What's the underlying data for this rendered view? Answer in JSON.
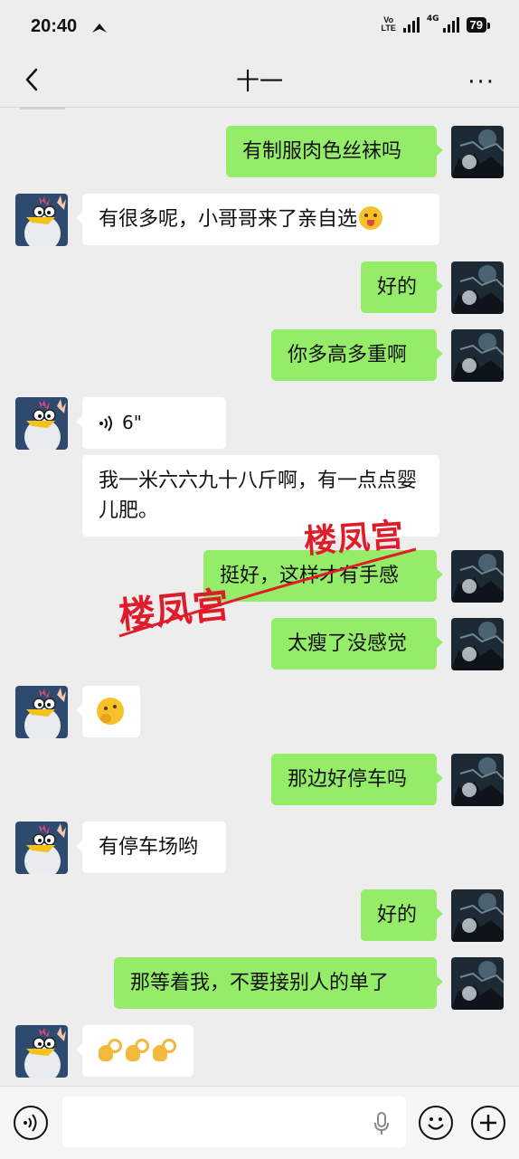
{
  "status_bar": {
    "time": "20:40",
    "volte_line1": "Vo",
    "volte_line2": "LTE",
    "network": "4G",
    "battery": "79"
  },
  "header": {
    "title": "十一",
    "more": "···"
  },
  "messages": [
    {
      "side": "me",
      "text": "有制服肉色丝袜吗"
    },
    {
      "side": "other",
      "text": "有很多呢，小哥哥来了亲自选",
      "emoji": "winking-tongue-face"
    },
    {
      "side": "me",
      "text": "好的"
    },
    {
      "side": "me",
      "text": "你多高多重啊"
    },
    {
      "side": "other",
      "type": "voice",
      "duration": "6\""
    },
    {
      "side": "other",
      "text": "我一米六六九十八斤啊，有一点点婴儿肥。"
    },
    {
      "side": "me",
      "text": "挺好，这样才有手感"
    },
    {
      "side": "me",
      "text": "太瘦了没感觉"
    },
    {
      "side": "other",
      "type": "emoji",
      "emoji": "thinking-face"
    },
    {
      "side": "me",
      "text": "那边好停车吗"
    },
    {
      "side": "other",
      "text": "有停车场哟"
    },
    {
      "side": "me",
      "text": "好的"
    },
    {
      "side": "me",
      "text": "那等着我，不要接别人的单了"
    },
    {
      "side": "other",
      "type": "emoji",
      "emoji": "ok-hand x3"
    }
  ],
  "watermark": {
    "text_left": "楼凤宫",
    "text_right": "楼凤宫",
    "color": "#e01b2a"
  },
  "colors": {
    "my_bubble": "#95ec69",
    "other_bubble": "#ffffff",
    "background": "#ededed"
  }
}
